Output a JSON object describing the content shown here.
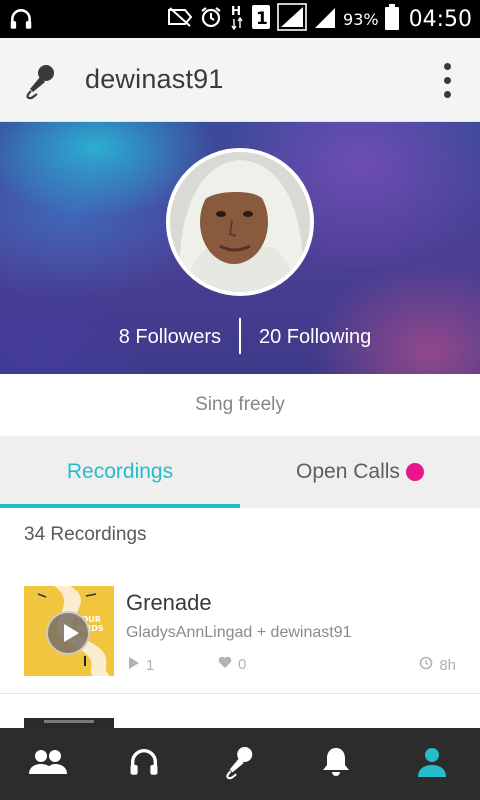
{
  "status_bar": {
    "battery": "93%",
    "time": "04:50",
    "icons": [
      "headphones-icon",
      "no-notifications-icon",
      "alarm-icon",
      "h-plus-network-icon",
      "sim-1-icon",
      "signal-icon",
      "signal-icon",
      "battery-icon"
    ]
  },
  "header": {
    "title": "dewinast91",
    "left_icon": "microphone-icon",
    "right_icon": "more-vertical-icon"
  },
  "profile": {
    "followers_label": "8 Followers",
    "following_label": "20 Following",
    "bio": "Sing freely"
  },
  "tabs": [
    {
      "label": "Recordings",
      "active": true
    },
    {
      "label": "Open Calls",
      "active": false,
      "badge": "notification-dot"
    }
  ],
  "recordings": {
    "count_label": "34 Recordings",
    "items": [
      {
        "title": "Grenade",
        "artists": "GladysAnnLingad + dewinast91",
        "plays": "1",
        "loves": "0",
        "age": "8h"
      }
    ]
  },
  "bottom_nav": [
    {
      "icon": "people-icon",
      "active": false
    },
    {
      "icon": "headphones-icon",
      "active": false
    },
    {
      "icon": "microphone-icon",
      "active": false
    },
    {
      "icon": "bell-icon",
      "active": false
    },
    {
      "icon": "profile-icon",
      "active": true
    }
  ],
  "colors": {
    "accent": "#26bcc9",
    "badge": "#e8168f",
    "nav_background": "#2c2c2c"
  }
}
